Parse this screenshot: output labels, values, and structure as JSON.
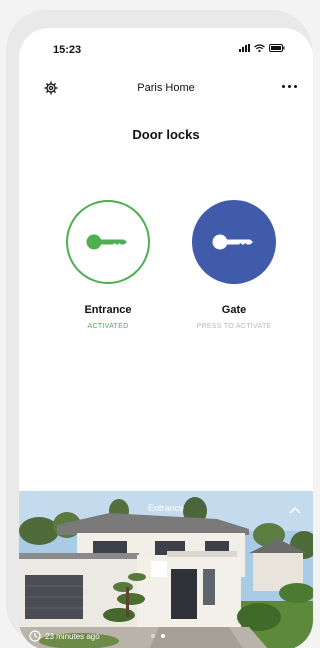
{
  "status_bar": {
    "time": "15:23"
  },
  "header": {
    "title": "Paris Home",
    "settings_icon": "gear-icon",
    "more_icon": "more-horizontal-icon"
  },
  "page": {
    "title": "Door locks"
  },
  "locks": [
    {
      "name": "Entrance",
      "status": "ACTIVATED",
      "icon": "key-icon",
      "color": "#4caf50"
    },
    {
      "name": "Gate",
      "status": "PRESS TO ACTIVATE",
      "icon": "key-icon",
      "color": "#3f5ba9"
    }
  ],
  "camera": {
    "label": "Entrance",
    "timestamp": "23 minutes ago",
    "collapse_icon": "chevron-up-icon",
    "clock_icon": "clock-icon",
    "pages": 2,
    "active_page": 2
  }
}
